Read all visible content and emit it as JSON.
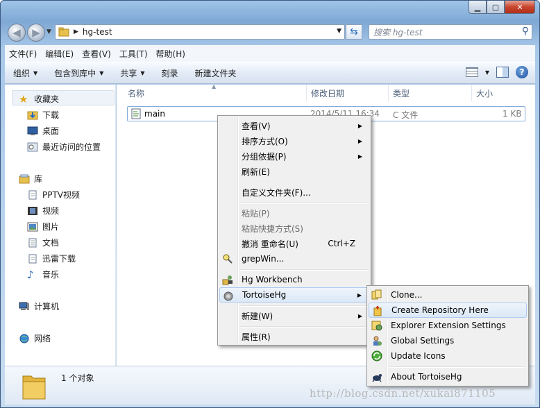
{
  "window": {
    "caption_buttons": [
      "minimize",
      "maximize",
      "close"
    ]
  },
  "address_bar": {
    "path": "hg-test",
    "search_placeholder": "搜索 hg-test"
  },
  "menu_bar": [
    "文件(F)",
    "编辑(E)",
    "查看(V)",
    "工具(T)",
    "帮助(H)"
  ],
  "toolbar": {
    "organize": "组织",
    "include_in_library": "包含到库中",
    "share": "共享",
    "burn": "刻录",
    "new_folder": "新建文件夹"
  },
  "nav_pane": {
    "favorites": "收藏夹",
    "favorites_items": [
      "下载",
      "桌面",
      "最近访问的位置"
    ],
    "libraries": "库",
    "libraries_items": [
      "PPTV视频",
      "视频",
      "图片",
      "文档",
      "迅雷下载",
      "音乐"
    ],
    "computer": "计算机",
    "network": "网络"
  },
  "columns": {
    "name": "名称",
    "date": "修改日期",
    "type": "类型",
    "size": "大小"
  },
  "file": {
    "name": "main",
    "date": "2014/5/11 16:34",
    "type": "C 文件",
    "size": "1 KB"
  },
  "status": {
    "count": "1 个对象"
  },
  "context_menu": {
    "view": "查看(V)",
    "sort_by": "排序方式(O)",
    "group_by": "分组依据(P)",
    "refresh": "刷新(E)",
    "customize": "自定义文件夹(F)...",
    "paste": "粘贴(P)",
    "paste_shortcut": "粘贴快捷方式(S)",
    "undo_rename": "撤消 重命名(U)",
    "undo_shortcut": "Ctrl+Z",
    "grepwin": "grepWin...",
    "hg_workbench": "Hg Workbench",
    "tortoisehg": "TortoiseHg",
    "new": "新建(W)",
    "properties": "属性(R)"
  },
  "submenu": {
    "clone": "Clone...",
    "create_repo": "Create Repository Here",
    "explorer_ext": "Explorer Extension Settings",
    "global_settings": "Global Settings",
    "update_icons": "Update Icons",
    "about": "About TortoiseHg"
  },
  "watermark": "http://blog.csdn.net/xukai871105",
  "colors": {
    "selection_border": "#84acdd",
    "menu_highlight": "#dbe8f7",
    "window_frame": "#7fa8d4"
  }
}
